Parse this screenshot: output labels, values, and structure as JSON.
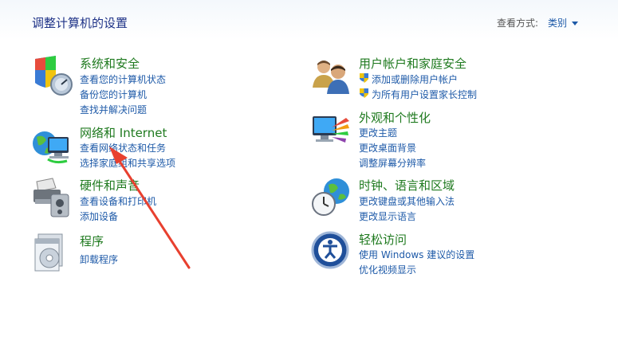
{
  "header": {
    "title": "调整计算机的设置",
    "view_label": "查看方式:",
    "view_value": "类别"
  },
  "categories": [
    {
      "title": "系统和安全",
      "icon": "system-security-icon",
      "links": [
        "查看您的计算机状态",
        "备份您的计算机",
        "查找并解决问题"
      ]
    },
    {
      "title": "网络和 Internet",
      "icon": "network-internet-icon",
      "links": [
        "查看网络状态和任务",
        "选择家庭组和共享选项"
      ]
    },
    {
      "title": "硬件和声音",
      "icon": "hardware-sound-icon",
      "links": [
        "查看设备和打印机",
        "添加设备"
      ]
    },
    {
      "title": "程序",
      "icon": "programs-icon",
      "links": [
        "卸载程序"
      ]
    },
    {
      "title": "用户帐户和家庭安全",
      "icon": "user-accounts-icon",
      "links": [
        "添加或删除用户帐户",
        "为所有用户设置家长控制"
      ]
    },
    {
      "title": "外观和个性化",
      "icon": "appearance-icon",
      "links": [
        "更改主题",
        "更改桌面背景",
        "调整屏幕分辨率"
      ]
    },
    {
      "title": "时钟、语言和区域",
      "icon": "clock-region-icon",
      "links": [
        "更改键盘或其他输入法",
        "更改显示语言"
      ]
    },
    {
      "title": "轻松访问",
      "icon": "ease-of-access-icon",
      "links": [
        "使用 Windows 建议的设置",
        "优化视频显示"
      ]
    }
  ],
  "annotation": {
    "icon": "red-arrow-annotation",
    "color": "#e8402f"
  },
  "colors": {
    "title_green": "#1f7a1f",
    "link_blue": "#1e5aa8",
    "heading_blue": "#1e3287"
  }
}
